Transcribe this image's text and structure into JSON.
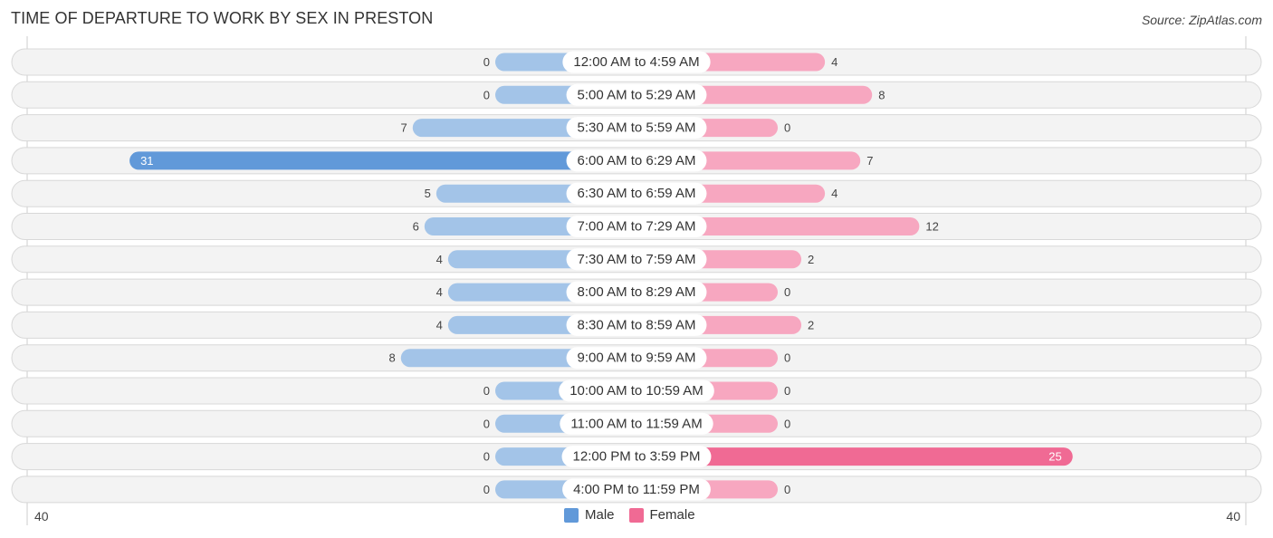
{
  "title": "TIME OF DEPARTURE TO WORK BY SEX IN PRESTON",
  "source": "Source: ZipAtlas.com",
  "colors": {
    "male": "#a3c4e8",
    "male_strong": "#6199d9",
    "female": "#f7a7c0",
    "female_strong": "#f06a94"
  },
  "chart_data": {
    "type": "bar",
    "orientation": "horizontal-diverging",
    "title": "TIME OF DEPARTURE TO WORK BY SEX IN PRESTON",
    "categories": [
      "12:00 AM to 4:59 AM",
      "5:00 AM to 5:29 AM",
      "5:30 AM to 5:59 AM",
      "6:00 AM to 6:29 AM",
      "6:30 AM to 6:59 AM",
      "7:00 AM to 7:29 AM",
      "7:30 AM to 7:59 AM",
      "8:00 AM to 8:29 AM",
      "8:30 AM to 8:59 AM",
      "9:00 AM to 9:59 AM",
      "10:00 AM to 10:59 AM",
      "11:00 AM to 11:59 AM",
      "12:00 PM to 3:59 PM",
      "4:00 PM to 11:59 PM"
    ],
    "series": [
      {
        "name": "Male",
        "values": [
          0,
          0,
          7,
          31,
          5,
          6,
          4,
          4,
          4,
          8,
          0,
          0,
          0,
          0
        ]
      },
      {
        "name": "Female",
        "values": [
          4,
          8,
          0,
          7,
          4,
          12,
          2,
          0,
          2,
          0,
          0,
          0,
          25,
          0
        ]
      }
    ],
    "axis": {
      "left_tick": "40",
      "right_tick": "40",
      "range": [
        40,
        40
      ]
    },
    "legend": {
      "position": "bottom-center",
      "entries": [
        "Male",
        "Female"
      ]
    },
    "xlabel": "",
    "ylabel": ""
  }
}
